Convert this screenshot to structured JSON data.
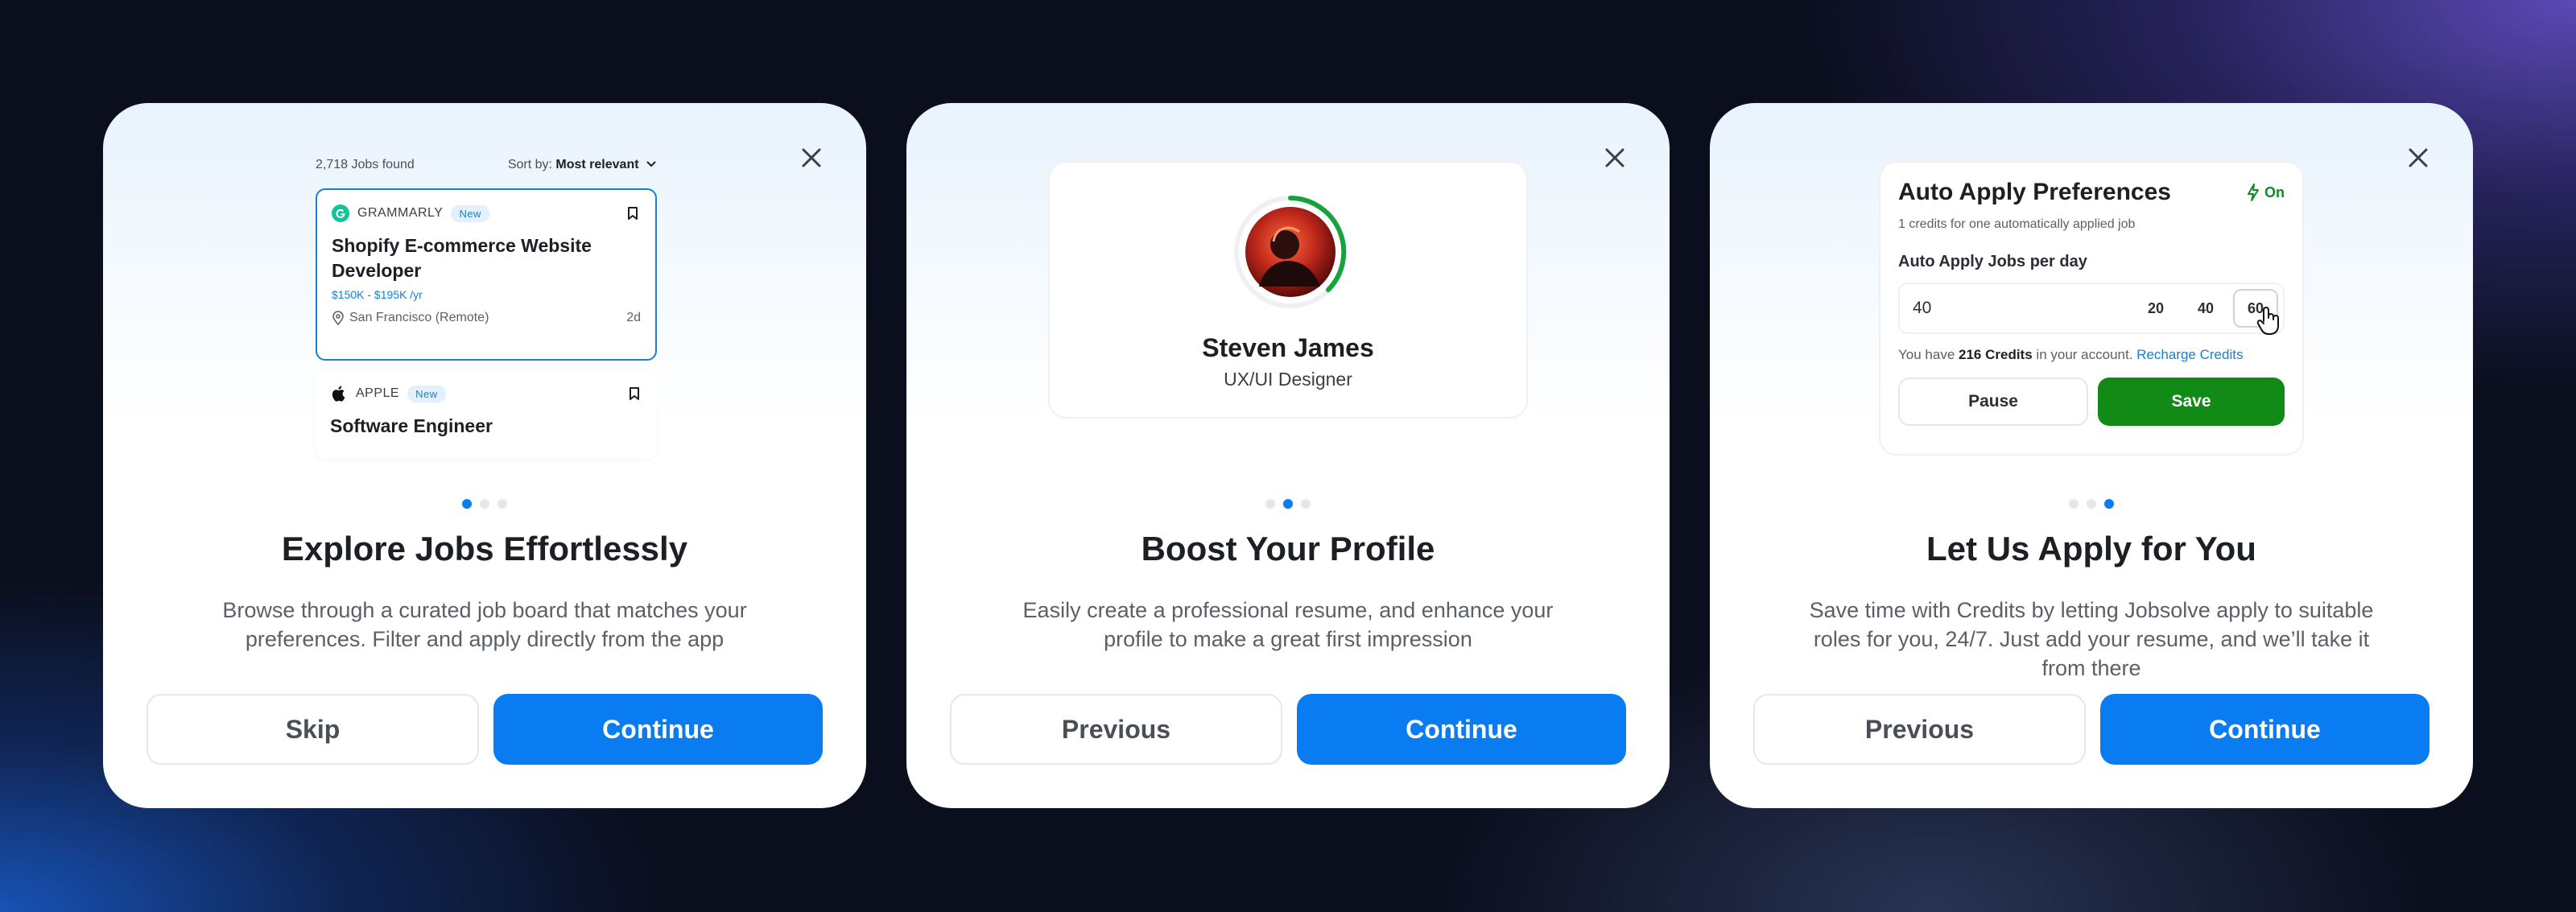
{
  "cards": [
    {
      "title": "Explore Jobs Effortlessly",
      "description": "Browse through a curated job board that matches your preferences. Filter and apply directly from the app",
      "secondary_button": "Skip",
      "primary_button": "Continue",
      "active_dot": 1,
      "jobs_found": "2,718 Jobs found",
      "sort_label": "Sort by:",
      "sort_value": "Most relevant",
      "jobs": [
        {
          "company": "GRAMMARLY",
          "badge": "New",
          "title": "Shopify E-commerce Website Developer",
          "salary": "$150K - $195K /yr",
          "location": "San Francisco (Remote)",
          "age": "2d"
        },
        {
          "company": "APPLE",
          "badge": "New",
          "title": "Software Engineer"
        }
      ]
    },
    {
      "title": "Boost Your Profile",
      "description": "Easily create a professional resume, and enhance your profile to make a great first impression",
      "secondary_button": "Previous",
      "primary_button": "Continue",
      "active_dot": 2,
      "profile_name": "Steven James",
      "profile_role": "UX/UI Designer"
    },
    {
      "title": "Let Us Apply for You",
      "description": "Save time with Credits by letting Jobsolve apply to suitable roles for you, 24/7. Just add your resume, and we’ll take it from there",
      "secondary_button": "Previous",
      "primary_button": "Continue",
      "active_dot": 3,
      "pref_title": "Auto Apply Preferences",
      "pref_status": "On",
      "pref_subtitle": "1 credits for one automatically applied job",
      "pref_label": "Auto Apply Jobs per day",
      "pref_value": "40",
      "pref_chips": [
        "20",
        "40",
        "60"
      ],
      "credits_prefix": "You have",
      "credits_amount": "216 Credits",
      "credits_suffix": "in your account.",
      "recharge_link": "Recharge Credits",
      "pause_button": "Pause",
      "save_button": "Save"
    }
  ],
  "colors": {
    "primary": "#0a7cf2",
    "success": "#118a16",
    "accent_blue": "#1580d6"
  }
}
